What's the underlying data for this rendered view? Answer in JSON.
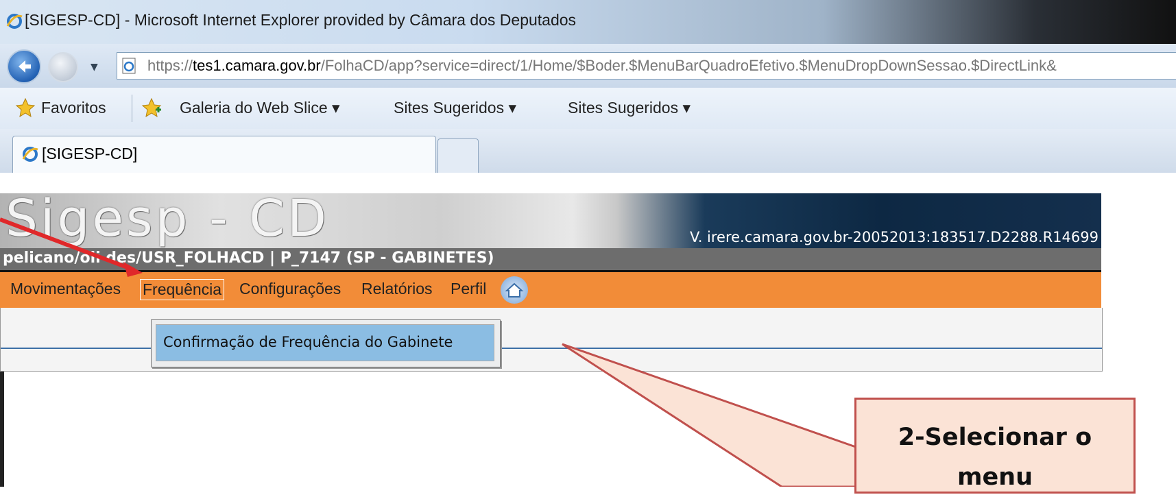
{
  "window": {
    "title": "[SIGESP-CD] - Microsoft Internet Explorer provided by Câmara dos Deputados"
  },
  "address_bar": {
    "url_scheme": "https://",
    "url_host": "tes1.camara.gov.br",
    "url_path": "/FolhaCD/app?service=direct/1/Home/$Boder.$MenuBarQuadroEfetivo.$MenuDropDownSessao.$DirectLink&"
  },
  "favorites_bar": {
    "favorites_label": "Favoritos",
    "items": [
      "Galeria do Web Slice ▾",
      "Sites Sugeridos ▾",
      "Sites Sugeridos ▾"
    ]
  },
  "tabs": [
    {
      "label": "[SIGESP-CD]"
    }
  ],
  "app": {
    "logo": "Sigesp - CD",
    "version": "V. irere.camara.gov.br-20052013:183517.D2288.R14699",
    "user_line": "pelicano/oli  des/USR_FOLHACD | P_7147 (SP - GABINETES)",
    "menu": [
      "Movimentações",
      "Frequência",
      "Configurações",
      "Relatórios",
      "Perfil"
    ],
    "active_menu": "Frequência",
    "dropdown_option": "Confirmação de Frequência do Gabinete"
  },
  "callout": {
    "line1": "2-Selecionar o",
    "line2": "menu"
  },
  "colors": {
    "menu_orange": "#f28c38",
    "callout_fill": "#fbe3d6",
    "callout_border": "#c0504d",
    "arrow_red": "#e0282a"
  }
}
